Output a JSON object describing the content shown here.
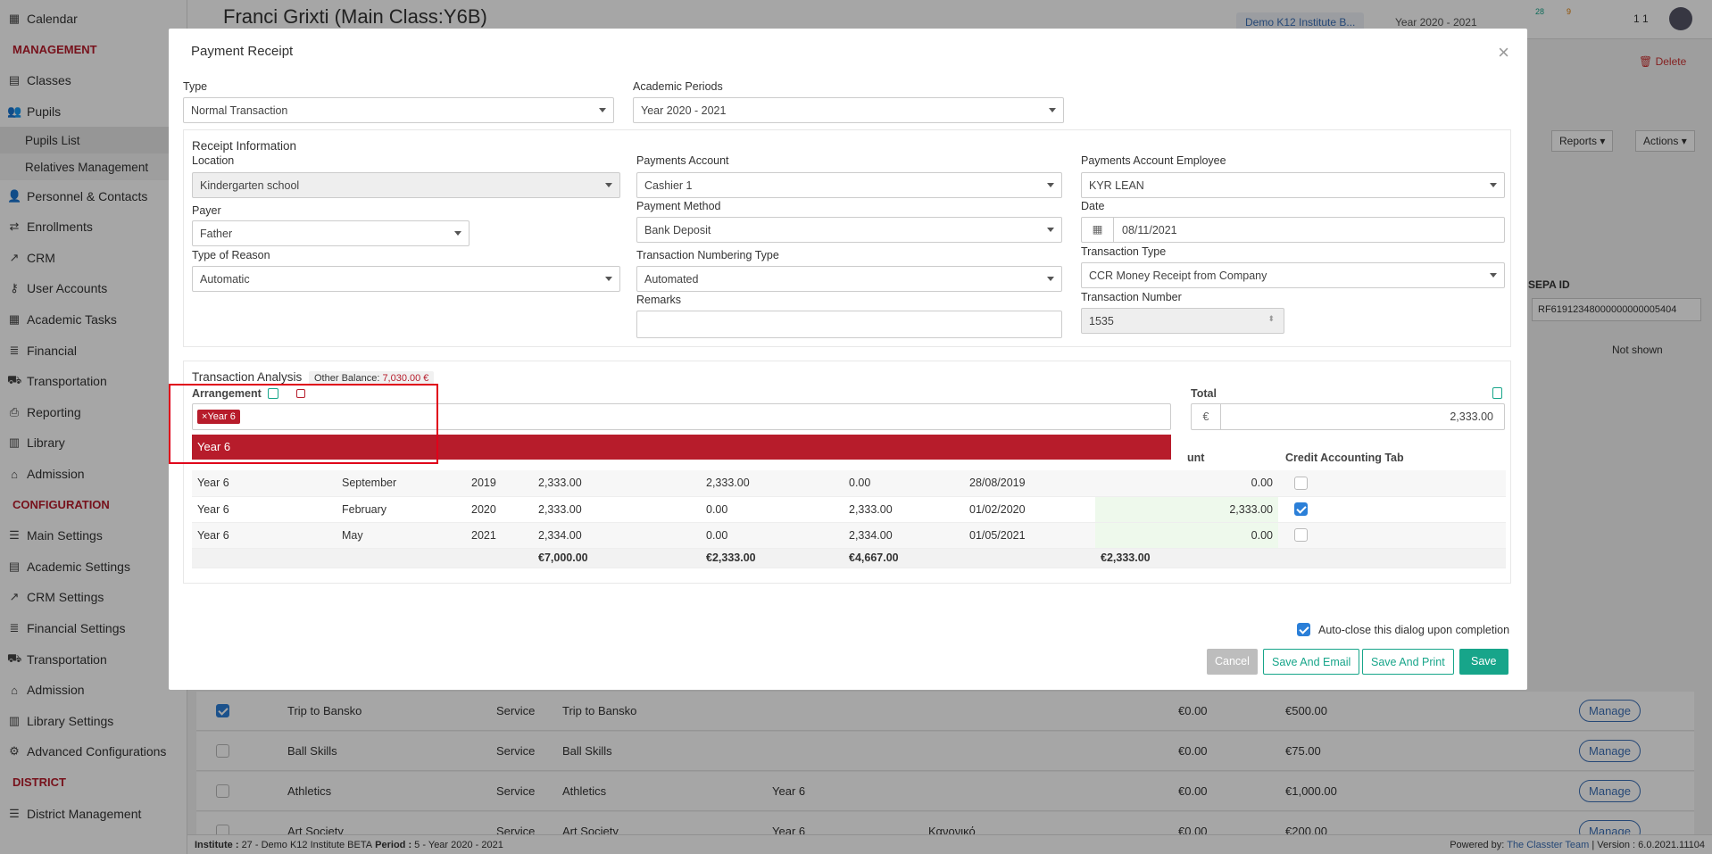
{
  "sidebar": {
    "items": [
      {
        "type": "item",
        "icon": "calendar-icon",
        "glyph": "▦",
        "label": "Calendar"
      },
      {
        "type": "head",
        "label": "MANAGEMENT"
      },
      {
        "type": "item",
        "icon": "classes-icon",
        "glyph": "▤",
        "label": "Classes"
      },
      {
        "type": "item",
        "icon": "pupils-icon",
        "glyph": "👥",
        "label": "Pupils"
      },
      {
        "type": "sub",
        "label": "Pupils List",
        "active": true
      },
      {
        "type": "sub",
        "label": "Relatives Management"
      },
      {
        "type": "item",
        "icon": "personnel-icon",
        "glyph": "👤",
        "label": "Personnel & Contacts"
      },
      {
        "type": "item",
        "icon": "enrollments-icon",
        "glyph": "⇄",
        "label": "Enrollments"
      },
      {
        "type": "item",
        "icon": "crm-icon",
        "glyph": "↗",
        "label": "CRM"
      },
      {
        "type": "item",
        "icon": "key-icon",
        "glyph": "⚷",
        "label": "User Accounts"
      },
      {
        "type": "item",
        "icon": "tasks-icon",
        "glyph": "▦",
        "label": "Academic Tasks"
      },
      {
        "type": "item",
        "icon": "financial-icon",
        "glyph": "≣",
        "label": "Financial"
      },
      {
        "type": "item",
        "icon": "bus-icon",
        "glyph": "⛟",
        "label": "Transportation"
      },
      {
        "type": "item",
        "icon": "printer-icon",
        "glyph": "⎙",
        "label": "Reporting"
      },
      {
        "type": "item",
        "icon": "library-icon",
        "glyph": "▥",
        "label": "Library"
      },
      {
        "type": "item",
        "icon": "admission-icon",
        "glyph": "⌂",
        "label": "Admission"
      },
      {
        "type": "head",
        "label": "CONFIGURATION"
      },
      {
        "type": "item",
        "icon": "settings-icon",
        "glyph": "☰",
        "label": "Main Settings"
      },
      {
        "type": "item",
        "icon": "academic-settings-icon",
        "glyph": "▤",
        "label": "Academic Settings"
      },
      {
        "type": "item",
        "icon": "crm-settings-icon",
        "glyph": "↗",
        "label": "CRM Settings"
      },
      {
        "type": "item",
        "icon": "financial-settings-icon",
        "glyph": "≣",
        "label": "Financial Settings"
      },
      {
        "type": "item",
        "icon": "bus-icon",
        "glyph": "⛟",
        "label": "Transportation"
      },
      {
        "type": "item",
        "icon": "admission-icon",
        "glyph": "⌂",
        "label": "Admission"
      },
      {
        "type": "item",
        "icon": "library-settings-icon",
        "glyph": "▥",
        "label": "Library Settings"
      },
      {
        "type": "item",
        "icon": "gears-icon",
        "glyph": "⚙",
        "label": "Advanced Configurations"
      },
      {
        "type": "head",
        "label": "DISTRICT"
      },
      {
        "type": "item",
        "icon": "district-icon",
        "glyph": "☰",
        "label": "District Management"
      }
    ]
  },
  "header": {
    "page_title": "Franci Grixti (Main Class:Y6B)",
    "institute": "Demo K12 Institute B...",
    "year": "Year 2020 - 2021",
    "badge1": "28",
    "badge2": "9",
    "user_num": "1 1"
  },
  "background": {
    "delete_label": "Delete",
    "reports_label": "Reports",
    "actions_label": "Actions",
    "sepa_label": "SEPA ID",
    "sepa_value": "RF61912348000000000005404",
    "not_shown": "Not shown",
    "manage_label": "Manage",
    "rows": [
      {
        "name": "Trip to Bansko",
        "type": "Service",
        "desc": "Trip to Bansko",
        "class": "",
        "extra": "",
        "bal": "€0.00",
        "amount": "€500.00"
      },
      {
        "name": "Ball Skills",
        "type": "Service",
        "desc": "Ball Skills",
        "class": "",
        "extra": "",
        "bal": "€0.00",
        "amount": "€75.00"
      },
      {
        "name": "Athletics",
        "type": "Service",
        "desc": "Athletics",
        "class": "Year 6",
        "extra": "",
        "bal": "€0.00",
        "amount": "€1,000.00"
      },
      {
        "name": "Art Society",
        "type": "Service",
        "desc": "Art Society",
        "class": "Year 6",
        "extra": "Κανονικό",
        "bal": "€0.00",
        "amount": "€200.00"
      }
    ]
  },
  "status": {
    "institute_label": "Institute :",
    "institute_value": "27 - Demo K12 Institute BETA",
    "period_label": "Period :",
    "period_value": "5 - Year 2020 - 2021",
    "powered": "Powered by:",
    "company": "The Classter Team",
    "version": "| Version : 6.0.2021.11104"
  },
  "modal": {
    "title": "Payment Receipt",
    "type_label": "Type",
    "type_value": "Normal Transaction",
    "periods_label": "Academic Periods",
    "periods_value": "Year 2020 - 2021",
    "receipt_info": "Receipt Information",
    "location_label": "Location",
    "location_value": "Kindergarten school",
    "payer_label": "Payer",
    "payer_value": "Father",
    "reason_label": "Type of Reason",
    "reason_value": "Automatic",
    "pay_account_label": "Payments Account",
    "pay_account_value": "Cashier 1",
    "pay_method_label": "Payment Method",
    "pay_method_value": "Bank Deposit",
    "numbering_label": "Transaction Numbering Type",
    "numbering_value": "Automated",
    "remarks_label": "Remarks",
    "employee_label": "Payments Account Employee",
    "employee_value": "KYR LEAN",
    "date_label": "Date",
    "date_value": "08/11/2021",
    "tx_type_label": "Transaction Type",
    "tx_type_value": "CCR Money Receipt from Company",
    "tx_number_label": "Transaction Number",
    "tx_number_value": "1535",
    "analysis_title": "Transaction Analysis",
    "other_balance_label": "Other Balance:",
    "other_balance_value": "7,030.00 €",
    "arrangement_label": "Arrangement",
    "tag_value": "Year 6",
    "dropdown_option": "Year 6",
    "total_label": "Total",
    "currency": "€",
    "total_value": "2,333.00",
    "col_amount_partial": "unt",
    "col_credit": "Credit Accounting Tab",
    "rows": [
      {
        "arr": "Year 6",
        "month": "September",
        "year": "2019",
        "amount": "2,333.00",
        "paid": "2,333.00",
        "balance": "0.00",
        "due": "28/08/2019",
        "pay": "0.00",
        "checked": false,
        "hl": false
      },
      {
        "arr": "Year 6",
        "month": "February",
        "year": "2020",
        "amount": "2,333.00",
        "paid": "0.00",
        "balance": "2,333.00",
        "due": "01/02/2020",
        "pay": "2,333.00",
        "checked": true,
        "hl": true
      },
      {
        "arr": "Year 6",
        "month": "May",
        "year": "2021",
        "amount": "2,334.00",
        "paid": "0.00",
        "balance": "2,334.00",
        "due": "01/05/2021",
        "pay": "0.00",
        "checked": false,
        "hl": true
      }
    ],
    "totals": {
      "amount": "€7,000.00",
      "paid": "€2,333.00",
      "balance": "€4,667.00",
      "pay": "€2,333.00"
    },
    "auto_close_label": "Auto-close this dialog upon completion",
    "cancel_label": "Cancel",
    "save_email_label": "Save And Email",
    "save_print_label": "Save And Print",
    "save_label": "Save"
  },
  "colors": {
    "brand_red": "#b71c2b",
    "teal": "#17a58a",
    "blue": "#2b7fd8"
  }
}
